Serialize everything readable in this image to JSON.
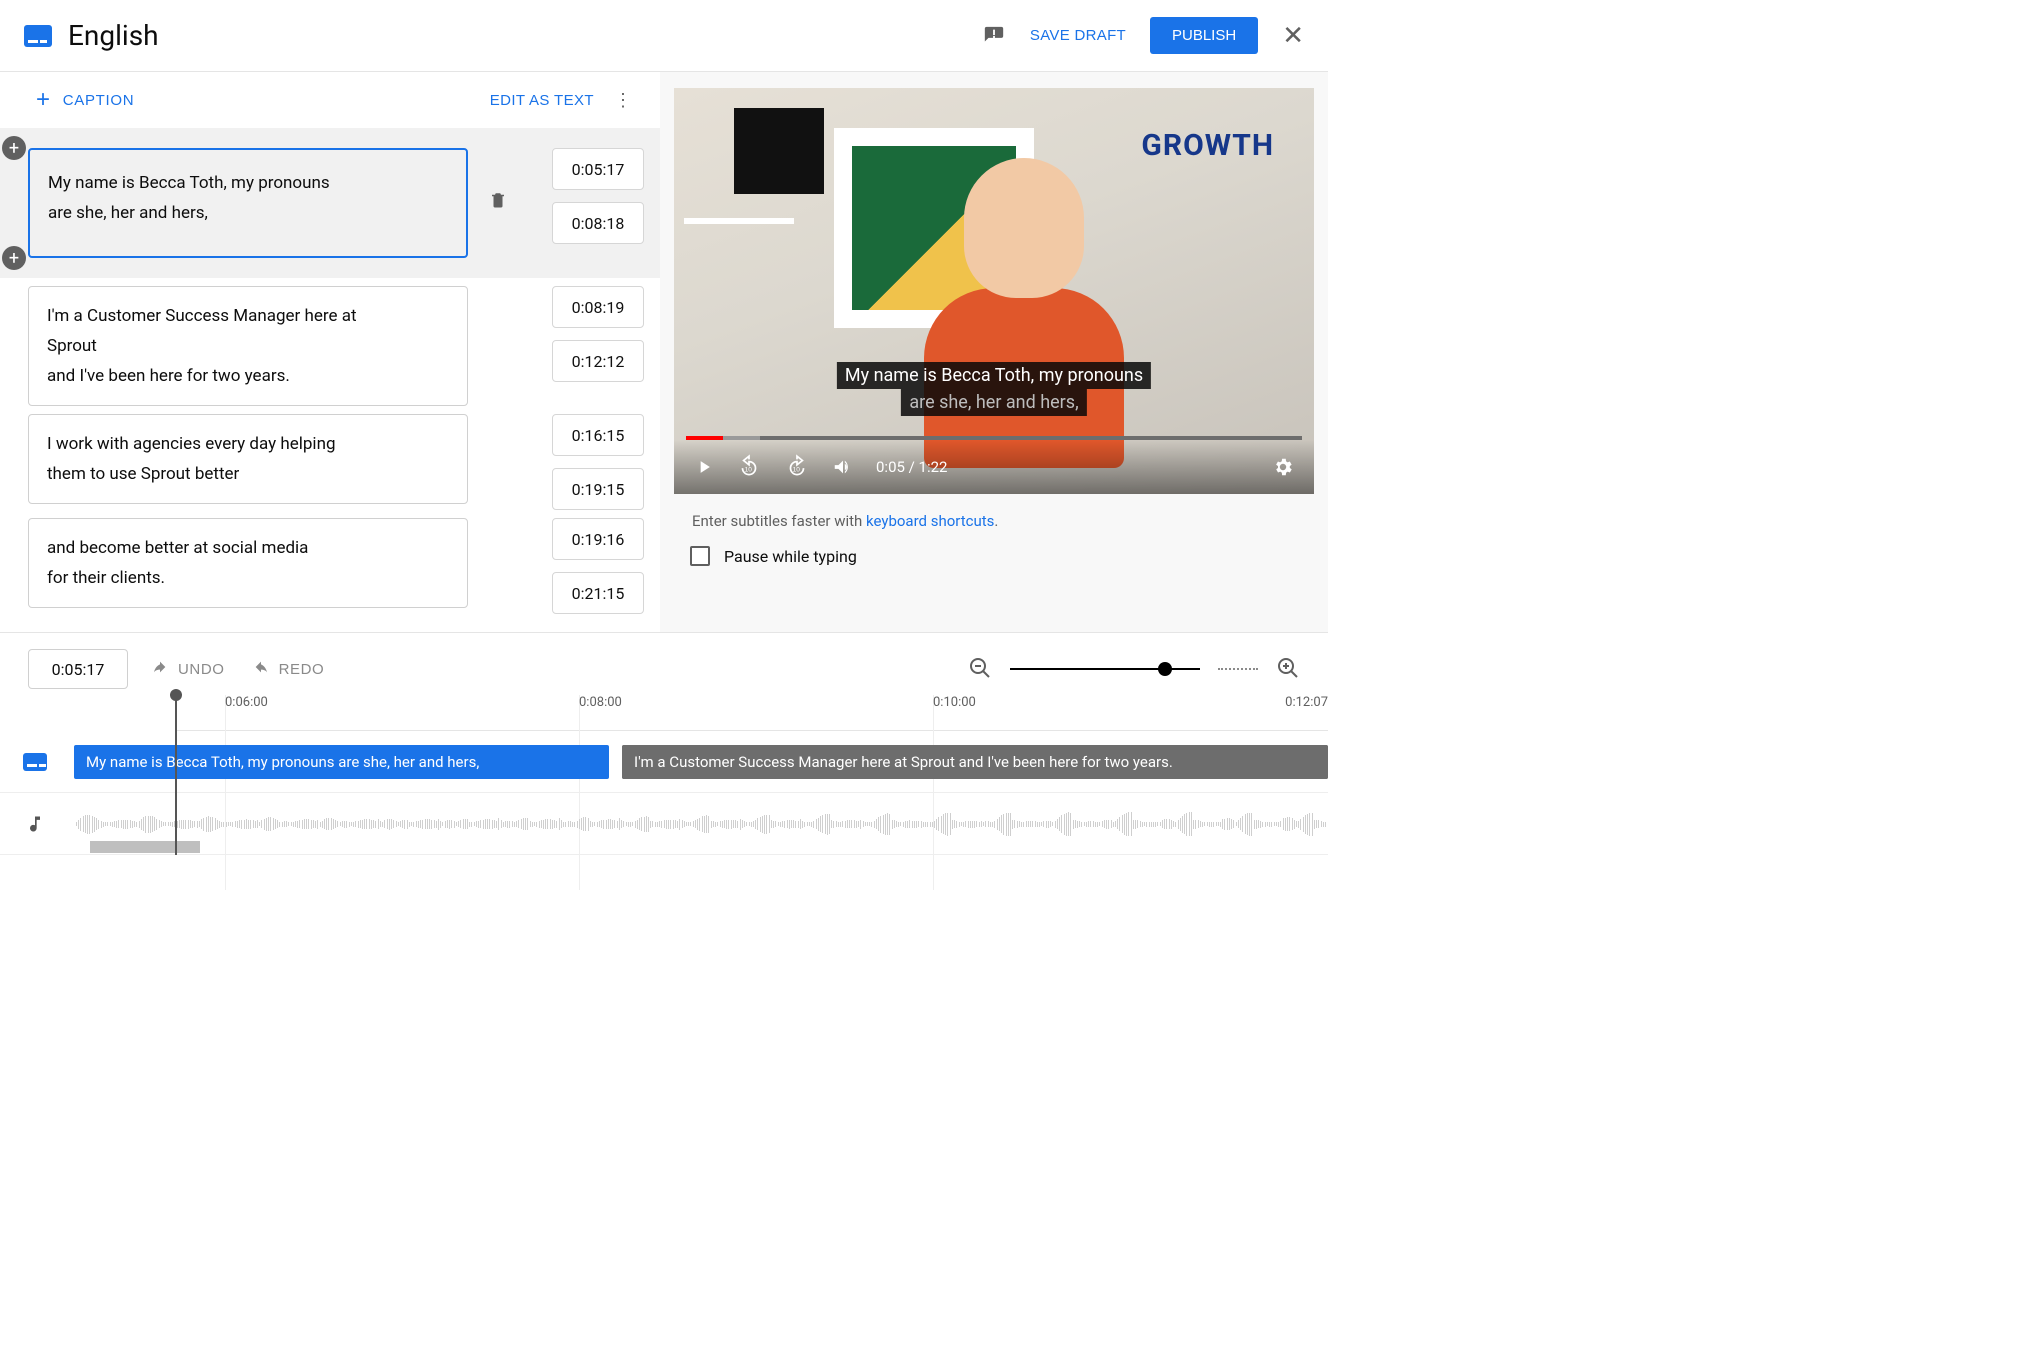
{
  "header": {
    "title": "English",
    "save_draft": "SAVE DRAFT",
    "publish": "PUBLISH"
  },
  "left_toolbar": {
    "add_caption": "CAPTION",
    "edit_as_text": "EDIT AS TEXT"
  },
  "captions": [
    {
      "text_l1": "My name is Becca Toth, my pronouns",
      "text_l2": "are she, her and hers,",
      "start": "0:05:17",
      "end": "0:08:18",
      "active": true
    },
    {
      "text_l1": "I'm a Customer Success Manager here at",
      "text_l2": "Sprout",
      "text_l3": "and I've been here for two years.",
      "start": "0:08:19",
      "end": "0:12:12"
    },
    {
      "text_l1": "I work with agencies every day helping",
      "text_l2": "them to use Sprout better",
      "start": "0:16:15",
      "end": "0:19:15"
    },
    {
      "text_l1": "and become better at social media",
      "text_l2": "for their clients.",
      "start": "0:19:16",
      "end": "0:21:15"
    }
  ],
  "video": {
    "cc_line1": "My name is Becca Toth, my pronouns",
    "cc_line2": "are she, her and hers,",
    "time_label": "0:05 / 1:22",
    "wall_text": "GROWTH"
  },
  "hint": {
    "prefix": "Enter subtitles faster with ",
    "link": "keyboard shortcuts",
    "suffix": "."
  },
  "pause_label": "Pause while typing",
  "timeline": {
    "current": "0:05:17",
    "undo": "UNDO",
    "redo": "REDO",
    "marks": [
      "0:06:00",
      "0:08:00",
      "0:10:00",
      "0:12:07"
    ],
    "clip1": "My name is Becca Toth, my pronouns are she, her and hers,",
    "clip2": "I'm a Customer Success Manager here at Sprout and I've been here for two years."
  }
}
